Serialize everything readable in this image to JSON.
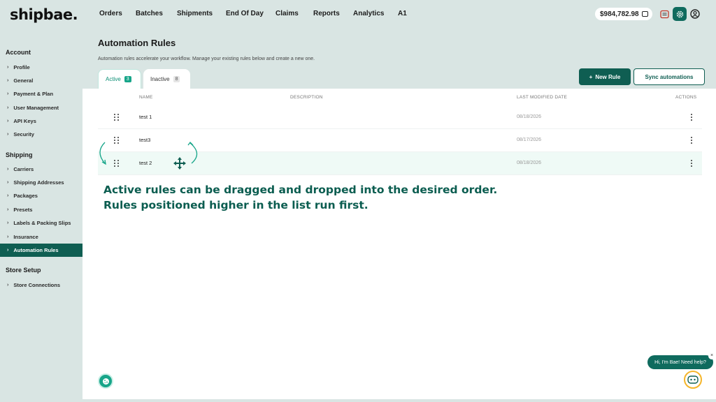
{
  "brand": {
    "logo": "shipbae."
  },
  "nav": {
    "items": [
      "Orders",
      "Batches",
      "Shipments",
      "End Of Day",
      "Claims",
      "Reports",
      "Analytics",
      "A1"
    ]
  },
  "header": {
    "balance": "$984,782.98"
  },
  "sidebar": {
    "sections": [
      {
        "title": "Account",
        "items": [
          "Profile",
          "General",
          "Payment & Plan",
          "User Management",
          "API Keys",
          "Security"
        ]
      },
      {
        "title": "Shipping",
        "items": [
          "Carriers",
          "Shipping Addresses",
          "Packages",
          "Presets",
          "Labels & Packing Slips",
          "Insurance",
          "Automation Rules"
        ]
      },
      {
        "title": "Store Setup",
        "items": [
          "Store Connections"
        ]
      }
    ],
    "active_item": "Automation Rules"
  },
  "page": {
    "title": "Automation Rules",
    "description": "Automation rules accelerate your workflow. Manage your existing rules below and create a new one."
  },
  "tabs": [
    {
      "label": "Active",
      "count": "3",
      "selected": true
    },
    {
      "label": "Inactive",
      "count": "8",
      "selected": false
    }
  ],
  "buttons": {
    "new_rule": "New Rule",
    "new_rule_icon": "+",
    "sync": "Sync automations"
  },
  "table": {
    "headers": {
      "name": "NAME",
      "description": "DESCRIPTION",
      "modified": "LAST MODIFIED DATE",
      "actions": "ACTIONS"
    },
    "rows": [
      {
        "name": "test 1",
        "description": "",
        "modified": "08/18/2026"
      },
      {
        "name": "test3",
        "description": "",
        "modified": "08/17/2026"
      },
      {
        "name": "test 2",
        "description": "",
        "modified": "08/18/2026"
      }
    ]
  },
  "callout": {
    "line1": "Active rules can be dragged and dropped into the desired order.",
    "line2": "Rules positioned higher in the list run first."
  },
  "chat": {
    "bubble": "Hi, I'm Bae! Need help?",
    "close": "×"
  },
  "colors": {
    "primary": "#0f5e52",
    "accent": "#17a589",
    "background": "#d9e5e3",
    "highlight_row": "#effaf6"
  },
  "icons": [
    "wallet-icon",
    "calendar-icon",
    "gear-icon",
    "user-icon",
    "drag-handle-icon",
    "move-icon",
    "kebab-icon",
    "cookie-icon",
    "chatbot-icon"
  ]
}
